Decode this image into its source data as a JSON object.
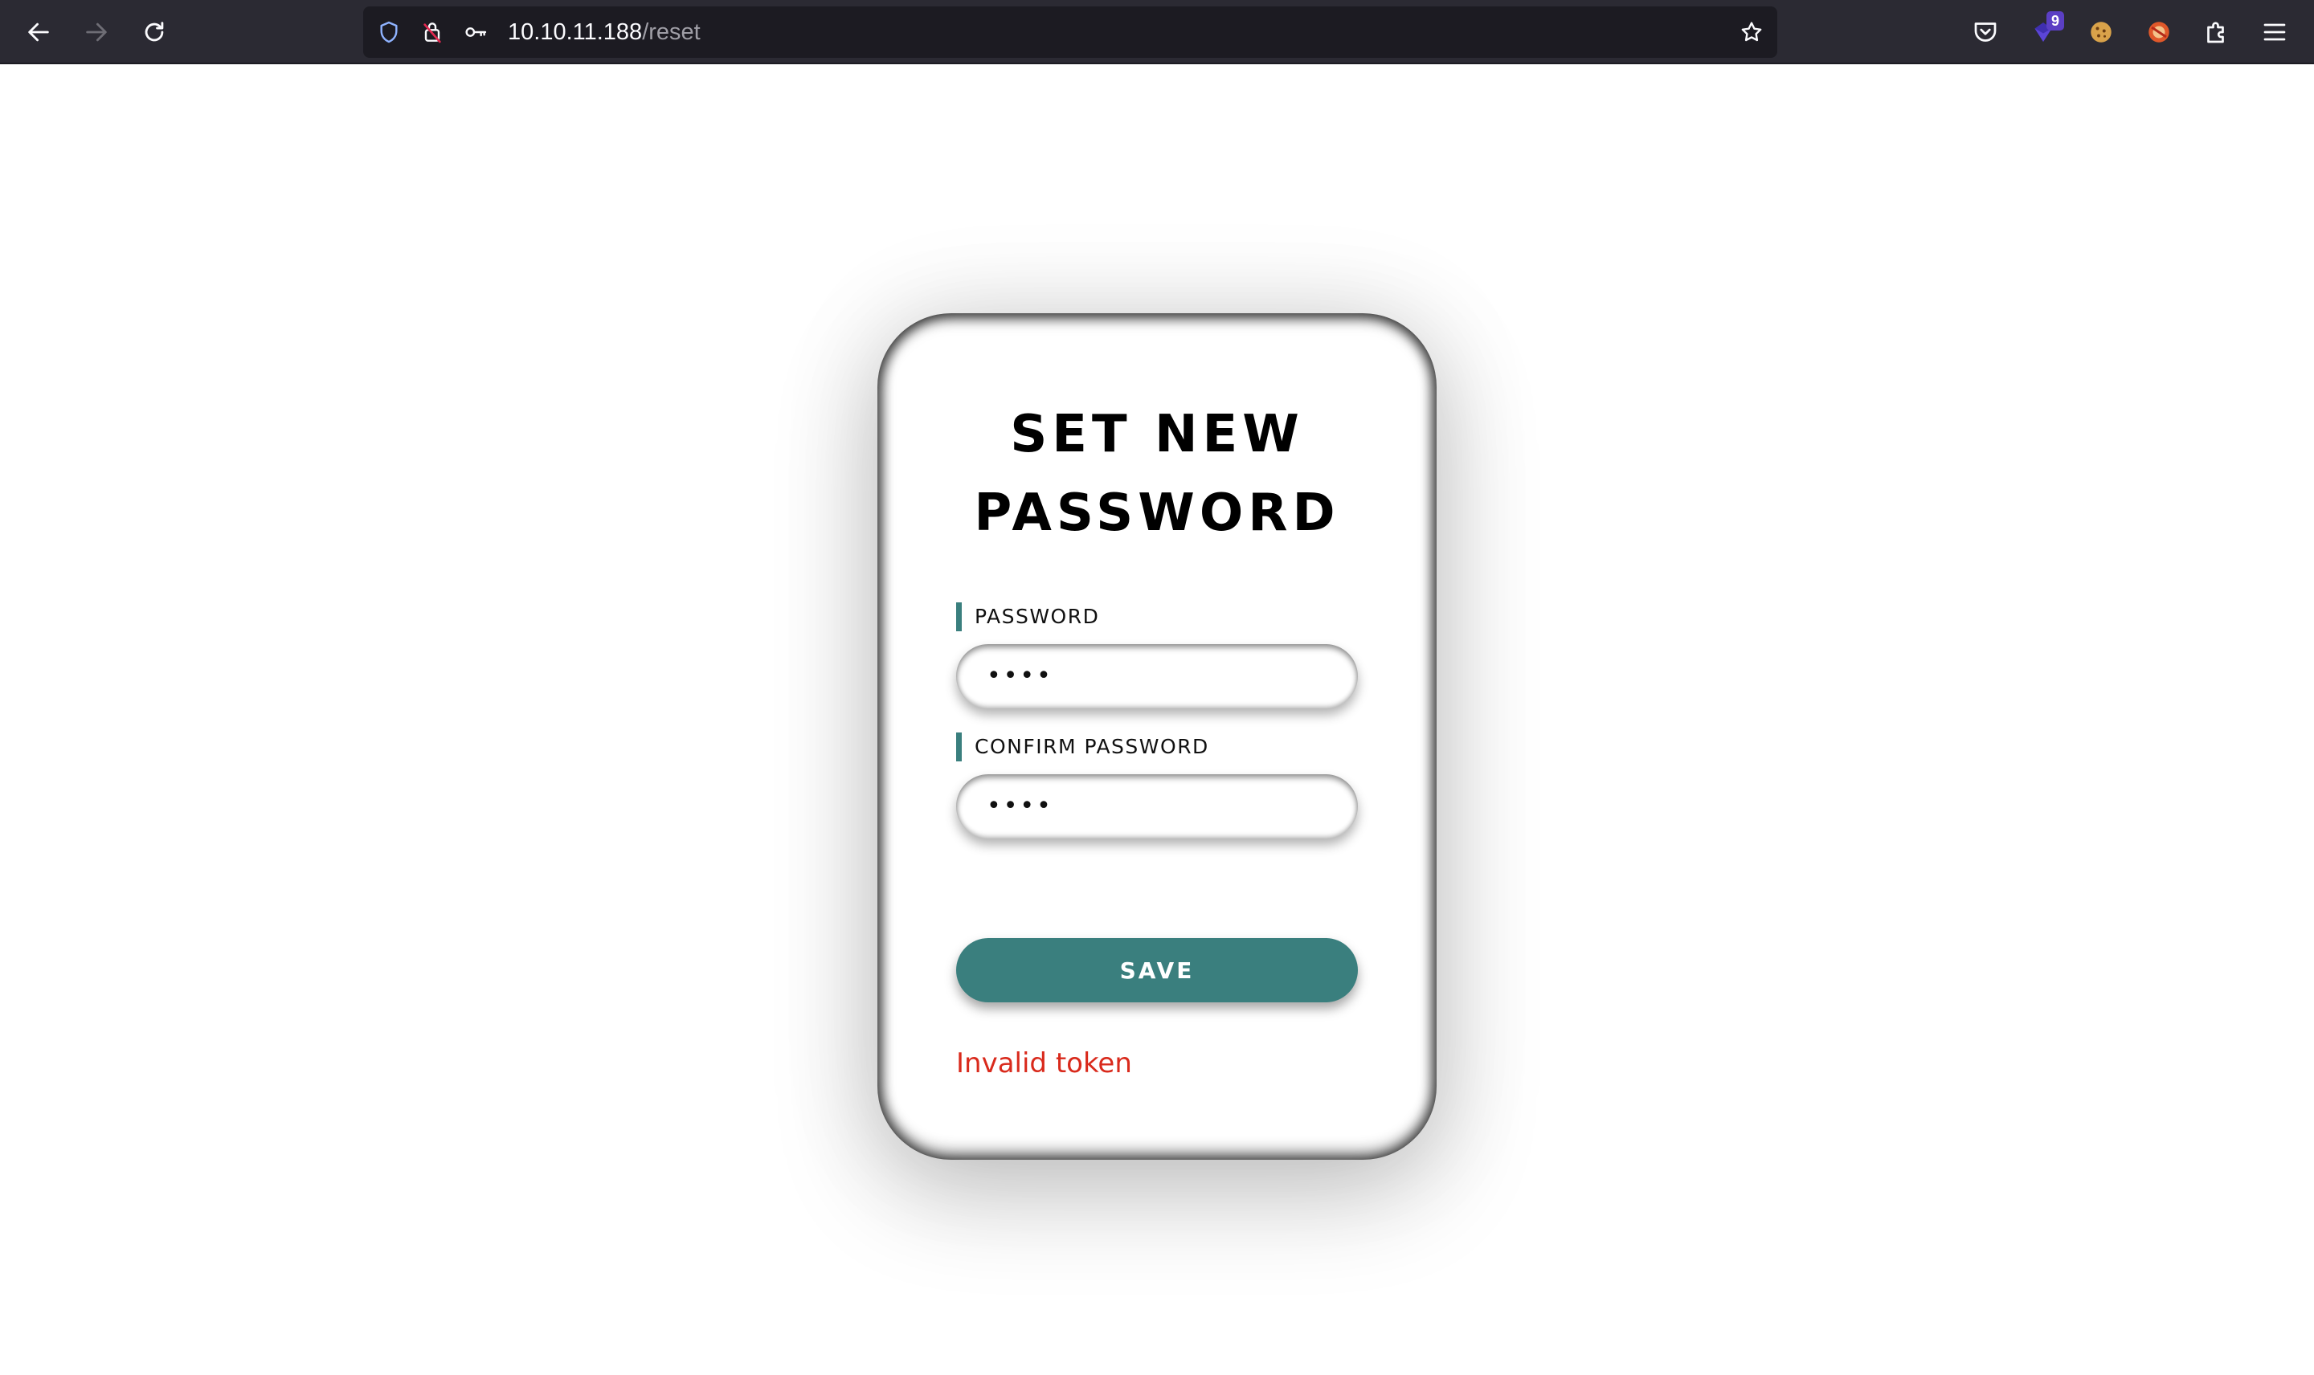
{
  "browser": {
    "url_host": "10.10.11.188",
    "url_path": "/reset",
    "extension_badge": "9",
    "icons": {
      "back": "arrow-left-icon",
      "forward": "arrow-right-icon",
      "reload": "reload-icon",
      "tracking": "shield-icon",
      "lock": "lock-insecure-icon",
      "key": "key-icon",
      "bookmark": "star-icon",
      "pocket": "pocket-icon",
      "extension_badge": "extension-icon",
      "cookie": "cookie-icon",
      "foxy": "addon-icon",
      "extensions": "puzzle-icon",
      "menu": "hamburger-menu-icon"
    }
  },
  "form": {
    "title_line1": "SET NEW",
    "title_line2": "PASSWORD",
    "password_label": "PASSWORD",
    "password_value": "••••",
    "confirm_label": "CONFIRM PASSWORD",
    "confirm_value": "••••",
    "save_label": "SAVE",
    "error_message": "Invalid token"
  },
  "colors": {
    "accent": "#3a7f7e",
    "error": "#d92a1c",
    "chrome_bg": "#2b2a33",
    "urlbar_bg": "#1c1b22"
  }
}
